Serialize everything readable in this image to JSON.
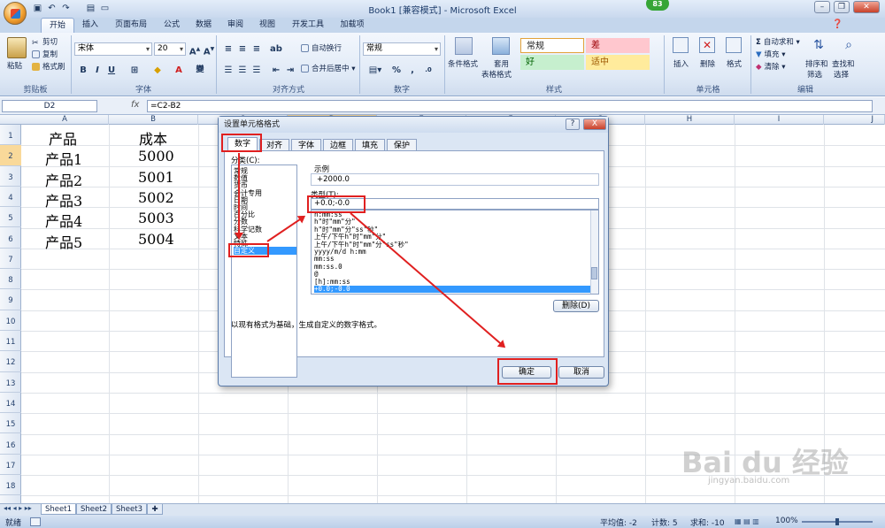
{
  "window": {
    "title": "Book1  [兼容模式] - Microsoft Excel",
    "badge": "83"
  },
  "tabs": [
    "开始",
    "插入",
    "页面布局",
    "公式",
    "数据",
    "审阅",
    "视图",
    "开发工具",
    "加载项"
  ],
  "ribbon": {
    "clipboard": {
      "paste": "粘贴",
      "cut": "剪切",
      "copy": "复制",
      "format_painter": "格式刷",
      "label": "剪贴板"
    },
    "font": {
      "name": "宋体",
      "size": "20",
      "label": "字体",
      "bold": "B",
      "italic": "I",
      "underline": "U",
      "wen": "變"
    },
    "alignment": {
      "wrap": "自动换行",
      "merge": "合并后居中",
      "label": "对齐方式"
    },
    "number": {
      "format": "常规",
      "percent": "%",
      "comma": ",",
      "label": "数字"
    },
    "styles": {
      "conditional": "条件格式",
      "table": "套用",
      "table2": "表格格式",
      "normal": "常规",
      "bad": "差",
      "good": "好",
      "neutral": "适中",
      "label": "样式"
    },
    "cells": {
      "insert": "插入",
      "delete": "删除",
      "format": "格式",
      "label": "单元格"
    },
    "editing": {
      "autosum": "自动求和",
      "fill": "填充",
      "clear": "清除",
      "sort": "排序和",
      "sort2": "筛选",
      "find": "查找和",
      "find2": "选择",
      "label": "编辑"
    }
  },
  "formula_bar": {
    "name_box": "D2",
    "fx": "fx",
    "formula": "=C2-B2"
  },
  "columns": [
    "A",
    "B",
    "C",
    "D",
    "E",
    "F",
    "G",
    "H",
    "I",
    "J"
  ],
  "rows": [
    "1",
    "2",
    "3",
    "4",
    "5",
    "6",
    "7",
    "8",
    "9",
    "10",
    "11",
    "12",
    "13",
    "14",
    "15",
    "16",
    "17",
    "18"
  ],
  "cells": {
    "a1": "产品",
    "b1": "成本",
    "a2": "产品1",
    "b2": "5000",
    "a3": "产品2",
    "b3": "5001",
    "a4": "产品3",
    "b4": "5002",
    "a5": "产品4",
    "b5": "5003",
    "a6": "产品5",
    "b6": "5004"
  },
  "sheets": [
    "Sheet1",
    "Sheet2",
    "Sheet3"
  ],
  "status": {
    "ready": "就绪",
    "average": "平均值: -2",
    "count": "计数: 5",
    "sum": "求和: -10",
    "zoom": "100%"
  },
  "dialog": {
    "title": "设置单元格格式",
    "tabs": [
      "数字",
      "对齐",
      "字体",
      "边框",
      "填充",
      "保护"
    ],
    "category_label": "分类(C):",
    "categories": [
      "常规",
      "数值",
      "货币",
      "会计专用",
      "日期",
      "时间",
      "百分比",
      "分数",
      "科学记数",
      "文本",
      "特殊",
      "自定义"
    ],
    "sample_label": "示例",
    "sample_value": "+2000.0",
    "type_label": "类型(T):",
    "type_value": "+0.0;-0.0",
    "formats": [
      "h:mm:ss",
      "h\"时\"mm\"分\"",
      "h\"时\"mm\"分\"ss\"秒\"",
      "上午/下午h\"时\"mm\"分\"",
      "上午/下午h\"时\"mm\"分\"ss\"秒\"",
      "yyyy/m/d h:mm",
      "mm:ss",
      "mm:ss.0",
      "@",
      "[h]:mm:ss",
      "+0.0;-0.0"
    ],
    "delete_button": "删除(D)",
    "description": "以现有格式为基础，生成自定义的数字格式。",
    "ok": "确定",
    "cancel": "取消",
    "help": "?",
    "close": "X"
  },
  "watermark": {
    "brand": "Bai du 经验",
    "url": "jingyan.baidu.com"
  }
}
